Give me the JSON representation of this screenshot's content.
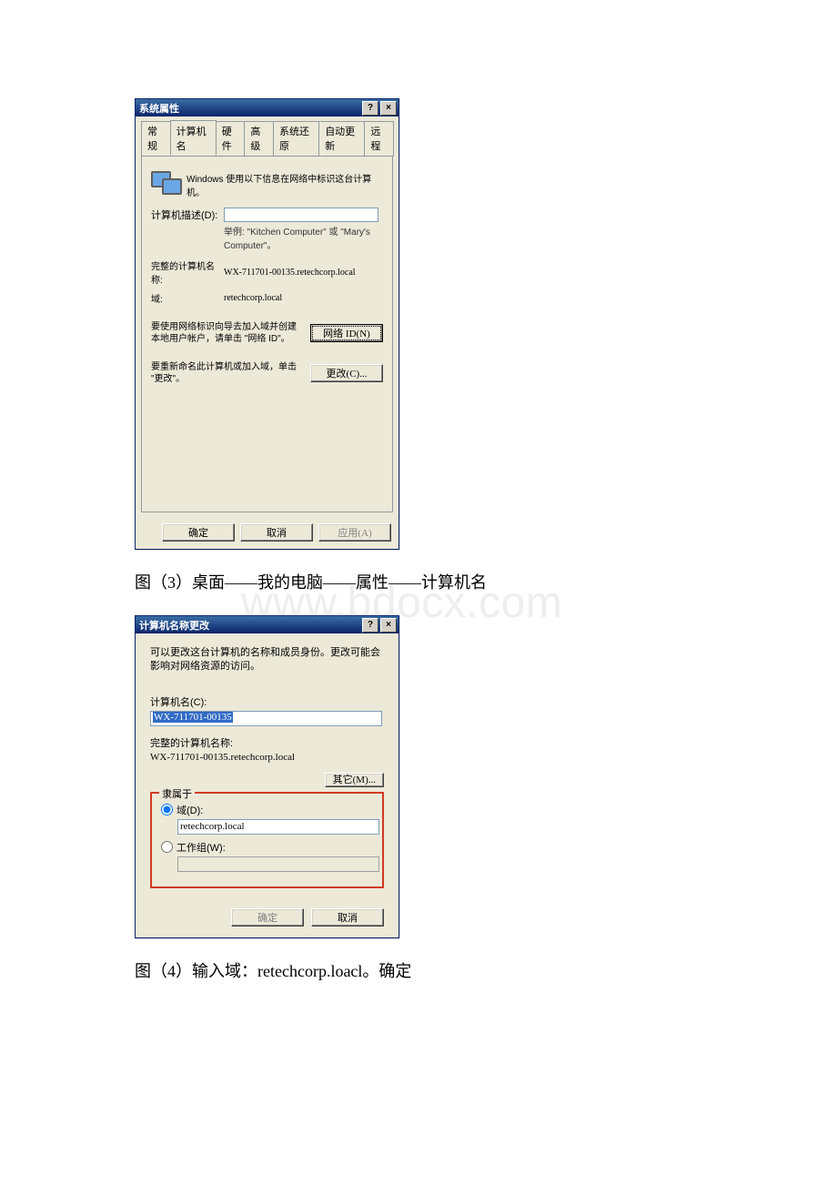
{
  "watermark": "www.bdocx.com",
  "dlg1": {
    "title": "系统属性",
    "help_btn": "?",
    "close_btn": "×",
    "tabs": [
      "常规",
      "计算机名",
      "硬件",
      "高级",
      "系统还原",
      "自动更新",
      "远程"
    ],
    "active_tab_index": 1,
    "info_text": "Windows 使用以下信息在网络中标识这台计算机。",
    "desc_label": "计算机描述(D):",
    "desc_value": "",
    "desc_hint": "举例: \"Kitchen Computer\" 或 \"Mary's Computer\"。",
    "fullname_label": "完整的计算机名称:",
    "fullname_value": "WX-711701-00135.retechcorp.local",
    "domain_label": "域:",
    "domain_value": "retechcorp.local",
    "netid_text": "要使用网络标识向导去加入域并创建本地用户帐户，请单击 \"网络 ID\"。",
    "netid_btn": "网络 ID(N)",
    "rename_text": "要重新命名此计算机或加入域，单击 \"更改\"。",
    "rename_btn": "更改(C)...",
    "ok": "确定",
    "cancel": "取消",
    "apply": "应用(A)"
  },
  "caption1": "图（3）桌面——我的电脑——属性——计算机名",
  "dlg2": {
    "title": "计算机名称更改",
    "help_btn": "?",
    "close_btn": "×",
    "desc": "可以更改这台计算机的名称和成员身份。更改可能会影响对网络资源的访问。",
    "name_label": "计算机名(C):",
    "name_value": "WX-711701-00135",
    "fullname_label": "完整的计算机名称:",
    "fullname_value": "WX-711701-00135.retechcorp.local",
    "other_btn": "其它(M)...",
    "group_legend": "隶属于",
    "radio_domain": "域(D):",
    "domain_value": "retechcorp.local",
    "radio_workgroup": "工作组(W):",
    "workgroup_value": "",
    "ok": "确定",
    "cancel": "取消"
  },
  "caption2": "图（4）输入域：retechcorp.loacl。确定"
}
